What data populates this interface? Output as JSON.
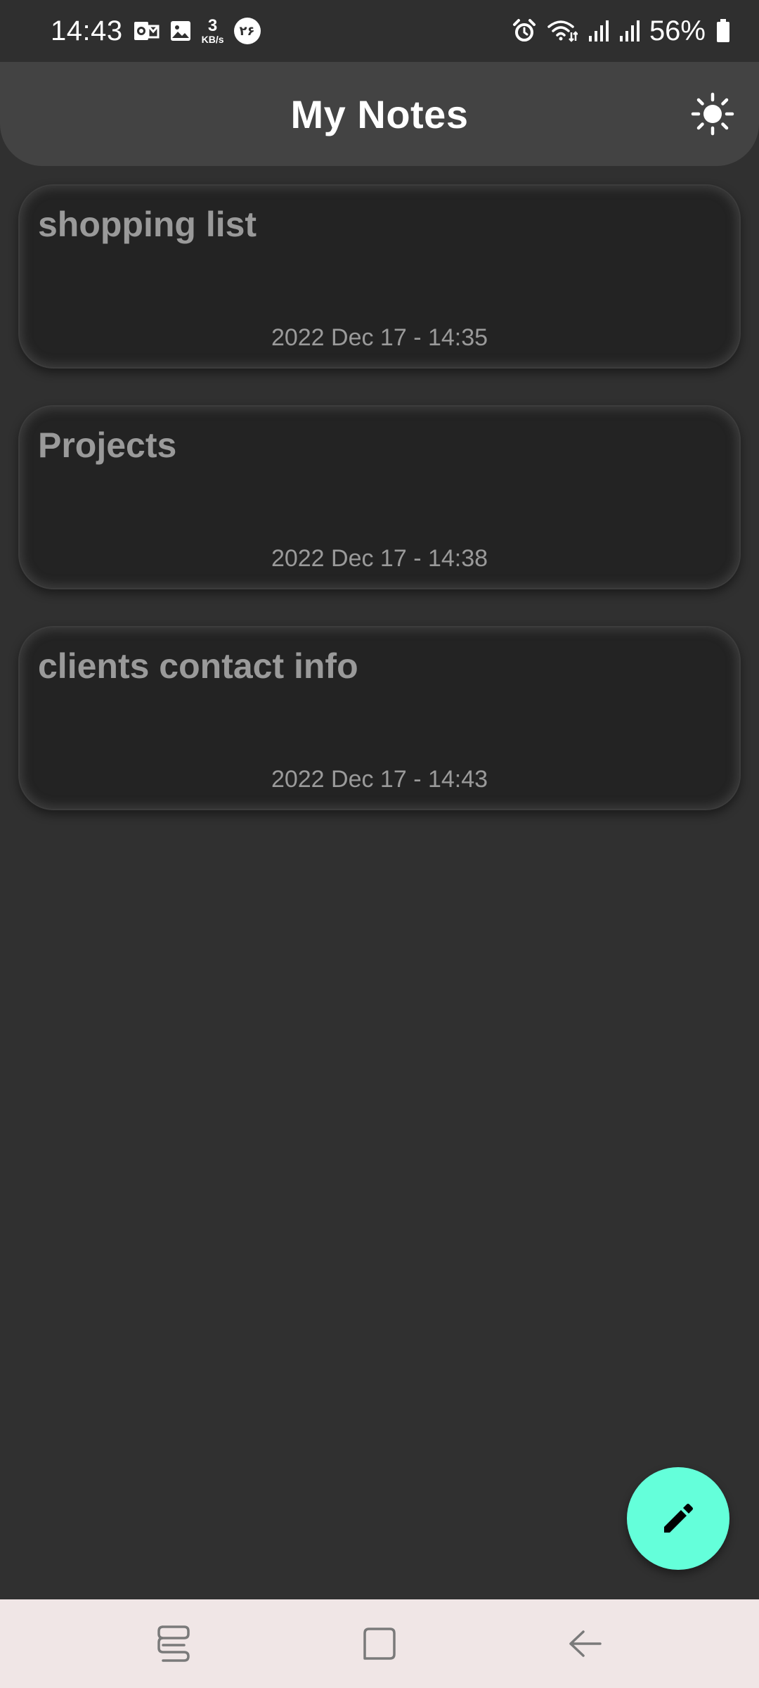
{
  "status_bar": {
    "time": "14:43",
    "net_speed_value": "3",
    "net_speed_unit": "KB/s",
    "notification_badge": "۲۶",
    "battery": "56%",
    "icons": [
      "outlook-icon",
      "gallery-icon",
      "alarm-icon",
      "wifi-icon",
      "signal-icon",
      "signal-icon",
      "battery-icon"
    ]
  },
  "app_bar": {
    "title": "My Notes",
    "theme_toggle_icon": "sun-icon"
  },
  "notes": [
    {
      "title": "shopping list",
      "date": "2022 Dec 17 - 14:35"
    },
    {
      "title": "Projects",
      "date": "2022 Dec 17 - 14:38"
    },
    {
      "title": "clients contact info",
      "date": "2022 Dec 17 - 14:43"
    }
  ],
  "fab": {
    "icon": "pencil-icon",
    "color": "#64ffda"
  },
  "nav_bar": {
    "buttons": [
      "recent-apps-icon",
      "home-icon",
      "back-icon"
    ]
  },
  "colors": {
    "background": "#303030",
    "app_bar": "#434343",
    "card": "#232323",
    "card_text": "#9a9a9a",
    "accent": "#64ffda",
    "nav_bar": "#f0e6e6"
  }
}
